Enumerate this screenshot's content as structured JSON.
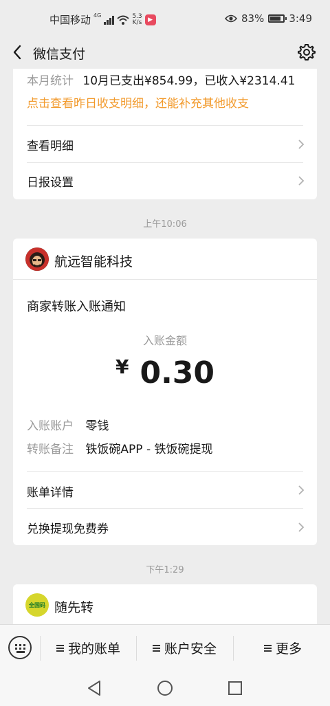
{
  "status_bar": {
    "carrier": "中国移动",
    "network": "4G",
    "speed_value": "5.3",
    "speed_unit": "K/s",
    "battery": "83%",
    "battery_level": 0.83,
    "time": "3:49"
  },
  "nav": {
    "title": "微信支付",
    "back_icon": "chevron-left-icon",
    "settings_icon": "gear-icon"
  },
  "summary_card": {
    "label": "本月统计",
    "stats": "10月已支出¥854.99，已收入¥2314.41",
    "hint": "点击查看昨日收支明细，还能补充其他收支",
    "items": [
      {
        "label": "查看明细"
      },
      {
        "label": "日报设置"
      }
    ]
  },
  "message1": {
    "time": "上午10:06",
    "merchant": "航远智能科技",
    "title": "商家转账入账通知",
    "amount_label": "入账金额",
    "currency": "¥",
    "amount": "0.30",
    "fields": [
      {
        "label": "入账账户",
        "value": "零钱"
      },
      {
        "label": "转账备注",
        "value": "铁饭碗APP - 铁饭碗提现"
      }
    ],
    "actions": [
      {
        "label": "账单详情"
      },
      {
        "label": "兑换提现免费券"
      }
    ]
  },
  "message2": {
    "time": "下午1:29",
    "merchant": "随先转",
    "avatar_text": "全国码"
  },
  "menu": {
    "items": [
      {
        "label": "我的账单"
      },
      {
        "label": "账户安全"
      },
      {
        "label": "更多"
      }
    ]
  },
  "colors": {
    "background": "#ededed",
    "card": "#ffffff",
    "hint_orange": "#f29a2c",
    "muted": "#9a9a9a"
  }
}
